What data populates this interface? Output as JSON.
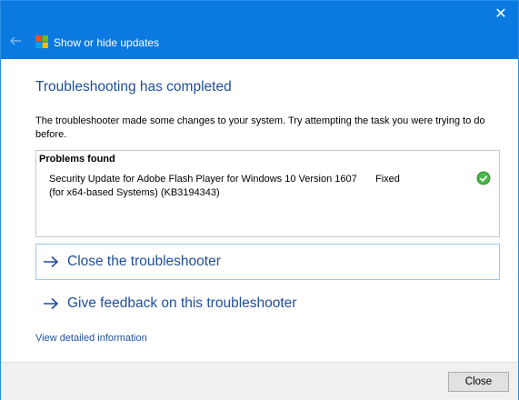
{
  "titlebar": {
    "title": "Show or hide updates",
    "close_glyph": "✕",
    "back_icon": "back-arrow-icon",
    "app_icon": "windows-logo-icon",
    "background_color": "#0a7ae0"
  },
  "main": {
    "heading": "Troubleshooting has completed",
    "description": "The troubleshooter made some changes to your system. Try attempting the task you were trying to do before.",
    "problems": {
      "title": "Problems found",
      "items": [
        {
          "name": "Security Update for Adobe Flash Player for Windows 10 Version 1607 (for x64-based Systems) (KB3194343)",
          "status": "Fixed",
          "status_icon": "green-check-icon",
          "status_color": "#3a9a3a"
        }
      ]
    },
    "links": [
      {
        "label": "Close the troubleshooter",
        "icon": "arrow-right-icon"
      },
      {
        "label": "Give feedback on this troubleshooter",
        "icon": "arrow-right-icon"
      }
    ],
    "detail_link": "View detailed information",
    "accent_color": "#1f4e9c"
  },
  "footer": {
    "close_label": "Close"
  }
}
